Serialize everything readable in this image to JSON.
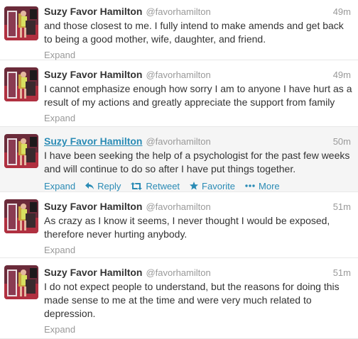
{
  "colors": {
    "link": "#2a8bb5",
    "muted": "#999999",
    "text": "#333333",
    "hover_bg": "#f5f5f5"
  },
  "tweets": [
    {
      "name": "Suzy Favor Hamilton",
      "handle": "@favorhamilton",
      "time": "49m",
      "lines": [
        "and those closest to me. I fully intend to make amends and get back",
        "to being a good mother, wife, daughter, and friend."
      ],
      "expand": "Expand"
    },
    {
      "name": "Suzy Favor Hamilton",
      "handle": "@favorhamilton",
      "time": "49m",
      "lines": [
        "I cannot emphasize enough how sorry I am to anyone I have hurt as a",
        "result of my actions and greatly appreciate the support from family"
      ],
      "expand": "Expand"
    },
    {
      "name": "Suzy Favor Hamilton",
      "handle": "@favorhamilton",
      "time": "50m",
      "lines": [
        "I have been seeking the help of a psychologist for the past few weeks",
        "and will continue to do so after I have put things together."
      ],
      "expand": "Expand",
      "reply": "Reply",
      "retweet": "Retweet",
      "favorite": "Favorite",
      "more": "More"
    },
    {
      "name": "Suzy Favor Hamilton",
      "handle": "@favorhamilton",
      "time": "51m",
      "lines": [
        "As crazy as I know it seems, I never thought I would be exposed,",
        "therefore never hurting anybody."
      ],
      "expand": "Expand"
    },
    {
      "name": "Suzy Favor Hamilton",
      "handle": "@favorhamilton",
      "time": "51m",
      "lines": [
        "I do not expect people to understand, but the reasons for doing this",
        "made sense to me at the time and were very much related to",
        "depression."
      ],
      "expand": "Expand"
    }
  ]
}
